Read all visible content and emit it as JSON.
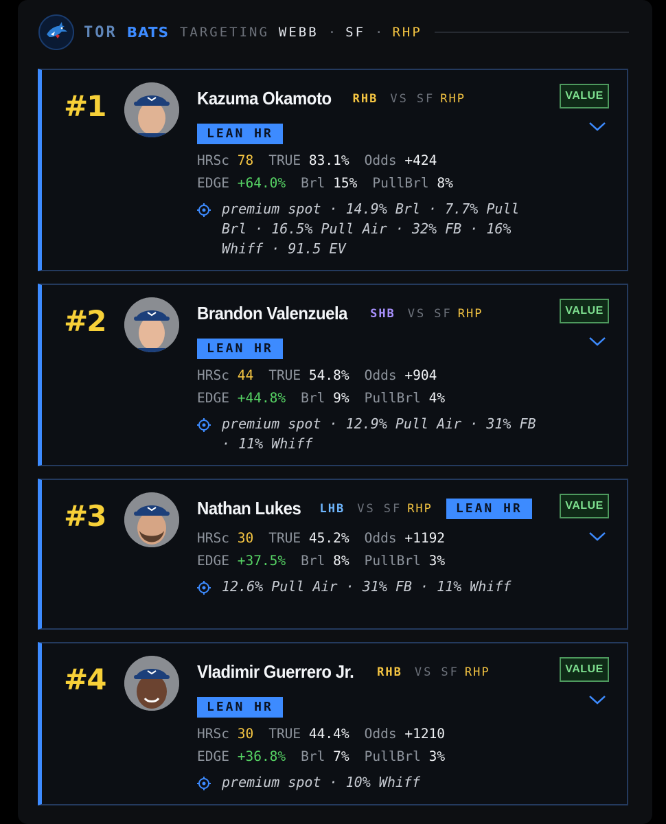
{
  "header": {
    "team": "TOR",
    "mode": "BATS",
    "targeting": "TARGETING",
    "pitcher": "WEBB",
    "sep": "·",
    "opp": "SF",
    "hand": "RHP"
  },
  "colors": {
    "accent": "#3d8bff",
    "yellow": "#f5c542",
    "green": "#56d364",
    "value_badge": "#7ee08f"
  },
  "players": [
    {
      "rank": "#1",
      "name": "Kazuma Okamoto",
      "bat": "RHB",
      "vs": "VS",
      "opp": "SF",
      "opp_hand": "RHP",
      "lean": "LEAN HR",
      "badge": "VALUE",
      "hrsc_label": "HRSc",
      "hrsc": "78",
      "true_label": "TRUE",
      "true": "83.1%",
      "odds_label": "Odds",
      "odds": "+424",
      "edge_label": "EDGE",
      "edge": "+64.0%",
      "brl_label": "Brl",
      "brl": "15%",
      "pullbrl_label": "PullBrl",
      "pullbrl": "8%",
      "note": "premium spot · 14.9% Brl · 7.7% Pull Brl · 16.5% Pull Air · 32% FB · 16% Whiff · 91.5 EV"
    },
    {
      "rank": "#2",
      "name": "Brandon Valenzuela",
      "bat": "SHB",
      "vs": "VS",
      "opp": "SF",
      "opp_hand": "RHP",
      "lean": "LEAN HR",
      "badge": "VALUE",
      "hrsc_label": "HRSc",
      "hrsc": "44",
      "true_label": "TRUE",
      "true": "54.8%",
      "odds_label": "Odds",
      "odds": "+904",
      "edge_label": "EDGE",
      "edge": "+44.8%",
      "brl_label": "Brl",
      "brl": "9%",
      "pullbrl_label": "PullBrl",
      "pullbrl": "4%",
      "note": "premium spot · 12.9% Pull Air · 31% FB · 11% Whiff"
    },
    {
      "rank": "#3",
      "name": "Nathan Lukes",
      "bat": "LHB",
      "vs": "VS",
      "opp": "SF",
      "opp_hand": "RHP",
      "lean": "LEAN HR",
      "badge": "VALUE",
      "hrsc_label": "HRSc",
      "hrsc": "30",
      "true_label": "TRUE",
      "true": "45.2%",
      "odds_label": "Odds",
      "odds": "+1192",
      "edge_label": "EDGE",
      "edge": "+37.5%",
      "brl_label": "Brl",
      "brl": "8%",
      "pullbrl_label": "PullBrl",
      "pullbrl": "3%",
      "note": "12.6% Pull Air · 31% FB · 11% Whiff"
    },
    {
      "rank": "#4",
      "name": "Vladimir Guerrero Jr.",
      "bat": "RHB",
      "vs": "VS",
      "opp": "SF",
      "opp_hand": "RHP",
      "lean": "LEAN HR",
      "badge": "VALUE",
      "hrsc_label": "HRSc",
      "hrsc": "30",
      "true_label": "TRUE",
      "true": "44.4%",
      "odds_label": "Odds",
      "odds": "+1210",
      "edge_label": "EDGE",
      "edge": "+36.8%",
      "brl_label": "Brl",
      "brl": "7%",
      "pullbrl_label": "PullBrl",
      "pullbrl": "3%",
      "note": "premium spot · 10% Whiff"
    }
  ]
}
